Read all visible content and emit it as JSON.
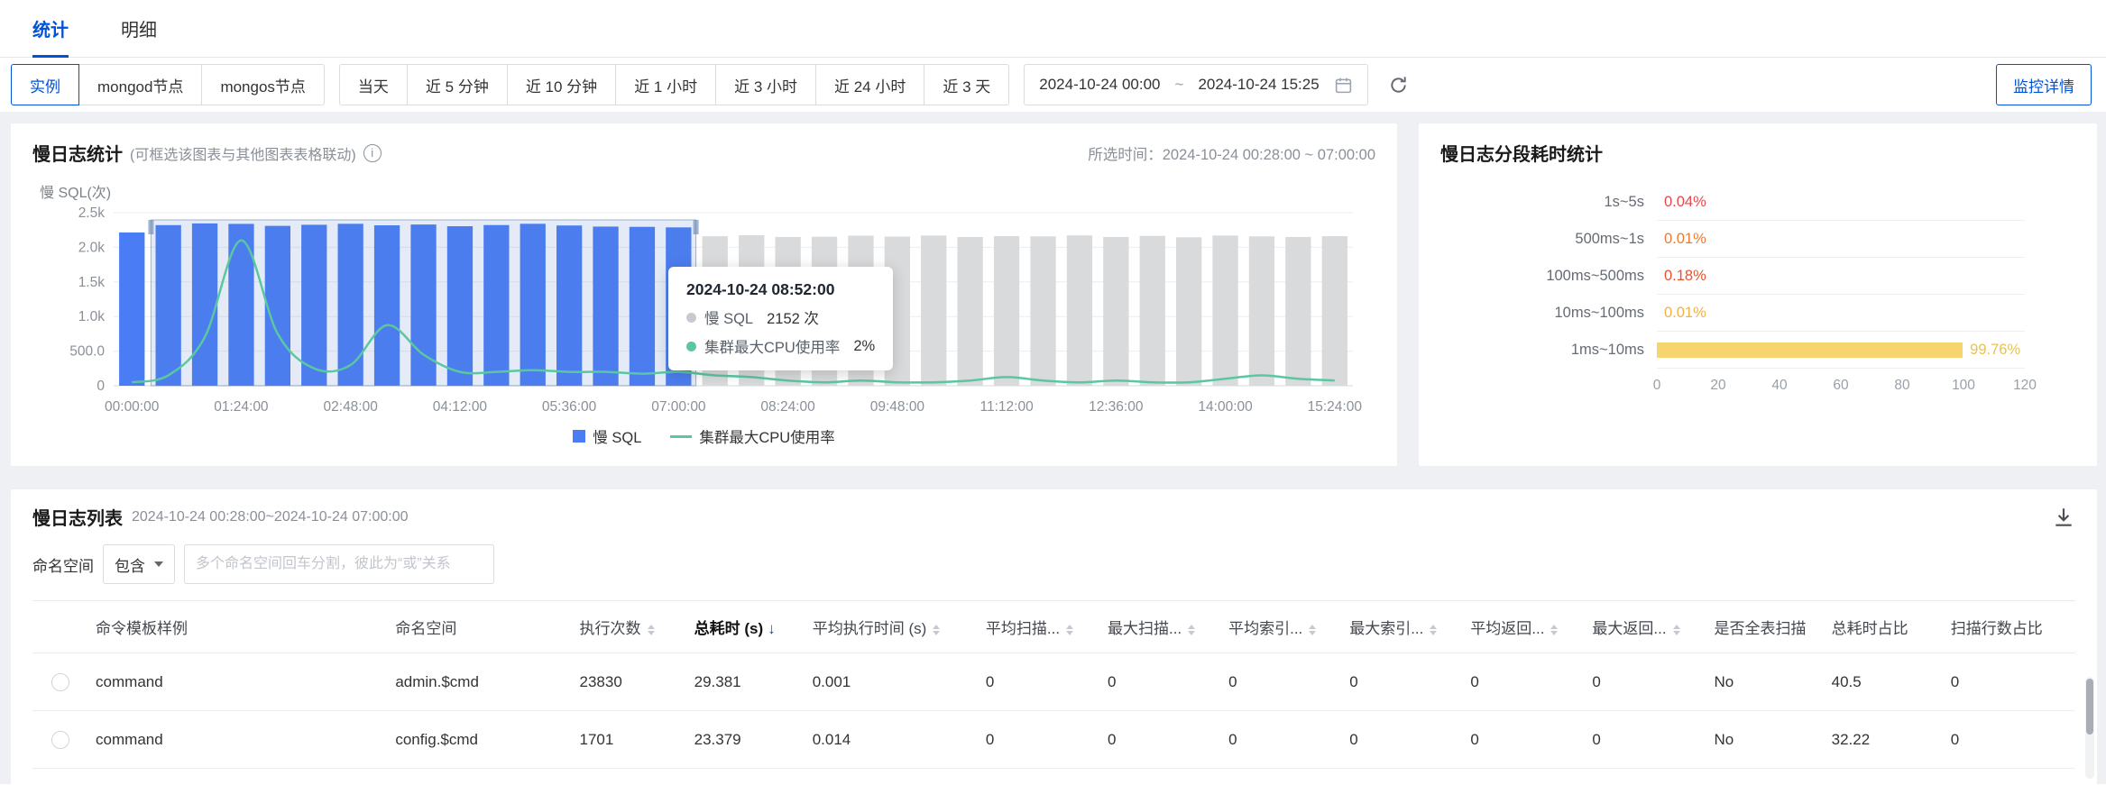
{
  "tabs": [
    {
      "label": "统计",
      "active": true
    },
    {
      "label": "明细",
      "active": false
    }
  ],
  "toolbar": {
    "node_buttons": [
      {
        "label": "实例",
        "active": true
      },
      {
        "label": "mongod节点",
        "active": false
      },
      {
        "label": "mongos节点",
        "active": false
      }
    ],
    "range_buttons": [
      {
        "label": "当天",
        "active": false
      },
      {
        "label": "近 5 分钟",
        "active": false
      },
      {
        "label": "近 10 分钟",
        "active": false
      },
      {
        "label": "近 1 小时",
        "active": false
      },
      {
        "label": "近 3 小时",
        "active": false
      },
      {
        "label": "近 24 小时",
        "active": false
      },
      {
        "label": "近 3 天",
        "active": false
      }
    ],
    "date_start": "2024-10-24 00:00",
    "date_separator": "~",
    "date_end": "2024-10-24 15:25",
    "monitor_link": "监控详情"
  },
  "slow_log_card": {
    "title": "慢日志统计",
    "subtitle": "(可框选该图表与其他图表表格联动)",
    "selected_time": "所选时间：2024-10-24 00:28:00 ~ 07:00:00",
    "tooltip": {
      "title": "2024-10-24 08:52:00",
      "rows": [
        {
          "name": "慢 SQL",
          "value": "2152 次",
          "color": "#c7cad1"
        },
        {
          "name": "集群最大CPU使用率",
          "value": "2%",
          "color": "#5bc7a0"
        }
      ]
    },
    "legend": [
      {
        "label": "慢 SQL",
        "type": "square",
        "color": "#4a7cf6"
      },
      {
        "label": "集群最大CPU使用率",
        "type": "line",
        "color": "#5bc7a0"
      }
    ]
  },
  "segment_card": {
    "title": "慢日志分段耗时统计"
  },
  "list_card": {
    "title": "慢日志列表",
    "subtitle": "2024-10-24 00:28:00~2024-10-24 07:00:00",
    "filter_label": "命名空间",
    "filter_operator": "包含",
    "filter_placeholder": "多个命名空间回车分割，彼此为“或”关系"
  },
  "icons": {
    "sort_desc": "↓"
  },
  "table": {
    "columns": [
      {
        "label": "命令模板样例",
        "sortable": false
      },
      {
        "label": "命名空间",
        "sortable": false
      },
      {
        "label": "执行次数",
        "sortable": true
      },
      {
        "label": "总耗时 (s)",
        "sortable": true,
        "sorted": "desc"
      },
      {
        "label": "平均执行时间 (s)",
        "sortable": true
      },
      {
        "label": "平均扫描...",
        "sortable": true
      },
      {
        "label": "最大扫描...",
        "sortable": true
      },
      {
        "label": "平均索引...",
        "sortable": true
      },
      {
        "label": "最大索引...",
        "sortable": true
      },
      {
        "label": "平均返回...",
        "sortable": true
      },
      {
        "label": "最大返回...",
        "sortable": true
      },
      {
        "label": "是否全表扫描",
        "sortable": false
      },
      {
        "label": "总耗时占比",
        "sortable": false
      },
      {
        "label": "扫描行数占比",
        "sortable": false
      }
    ],
    "rows": [
      [
        "command",
        "admin.$cmd",
        "23830",
        "29.381",
        "0.001",
        "0",
        "0",
        "0",
        "0",
        "0",
        "0",
        "No",
        "40.5",
        "0"
      ],
      [
        "command",
        "config.$cmd",
        "1701",
        "23.379",
        "0.014",
        "0",
        "0",
        "0",
        "0",
        "0",
        "0",
        "No",
        "32.22",
        "0"
      ]
    ]
  },
  "chart_data": [
    {
      "type": "bar",
      "title": "慢日志统计",
      "y_axis_title": "慢 SQL(次)",
      "ylim": [
        0,
        2500
      ],
      "y_tick_labels": [
        "0",
        "500.0",
        "1.0k",
        "1.5k",
        "2.0k",
        "2.5k"
      ],
      "x_tick_labels": [
        "00:00:00",
        "01:24:00",
        "02:48:00",
        "04:12:00",
        "05:36:00",
        "07:00:00",
        "08:24:00",
        "09:48:00",
        "11:12:00",
        "12:36:00",
        "14:00:00",
        "15:24:00"
      ],
      "x_interval_minutes": 28,
      "series": [
        {
          "name": "慢 SQL",
          "type": "bar",
          "unit": "次",
          "values": [
            2215,
            2320,
            2345,
            2338,
            2310,
            2325,
            2340,
            2318,
            2330,
            2305,
            2322,
            2340,
            2315,
            2300,
            2296,
            2288,
            2160,
            2175,
            2150,
            2152,
            2168,
            2155,
            2170,
            2148,
            2162,
            2158,
            2172,
            2150,
            2165,
            2145,
            2170,
            2158,
            2150,
            2162
          ]
        },
        {
          "name": "集群最大CPU使用率",
          "type": "line",
          "unit": "%",
          "values": [
            2,
            6,
            28,
            84,
            30,
            10,
            12,
            35,
            18,
            8,
            8,
            9,
            8,
            8,
            7,
            8,
            6,
            5,
            3,
            2,
            3,
            2,
            2,
            3,
            5,
            3,
            2,
            3,
            2,
            2,
            4,
            6,
            4,
            3
          ]
        }
      ],
      "selection": {
        "time_range": "2024-10-24 00:28:00 ~ 07:00:00",
        "brush_start_index": 1,
        "brush_end_index": 15,
        "highlight_start_index": 0,
        "highlight_end_index": 15
      },
      "colors": {
        "bar_selected": "#4a7cf6",
        "bar_unselected": "#d9dadc",
        "line": "#5bc7a0",
        "selection_fill": "rgba(88,128,196,0.16)",
        "selection_border": "rgba(110,140,185,0.65)"
      },
      "legend_position": "bottom"
    },
    {
      "type": "bar_horizontal",
      "title": "慢日志分段耗时统计",
      "categories": [
        "1s~5s",
        "500ms~1s",
        "100ms~500ms",
        "10ms~100ms",
        "1ms~10ms"
      ],
      "values": [
        0.04,
        0.01,
        0.18,
        0.01,
        99.76
      ],
      "value_labels": [
        "0.04%",
        "0.01%",
        "0.18%",
        "0.01%",
        "99.76%"
      ],
      "label_colors": [
        "#e5484d",
        "#ed7b2f",
        "#e5542e",
        "#f2b04a",
        "#e9c155"
      ],
      "bar_color": "#f6d56e",
      "xlim": [
        0,
        120
      ],
      "x_ticks": [
        0,
        20,
        40,
        60,
        80,
        100,
        120
      ],
      "xlabel": "",
      "ylabel": ""
    }
  ]
}
